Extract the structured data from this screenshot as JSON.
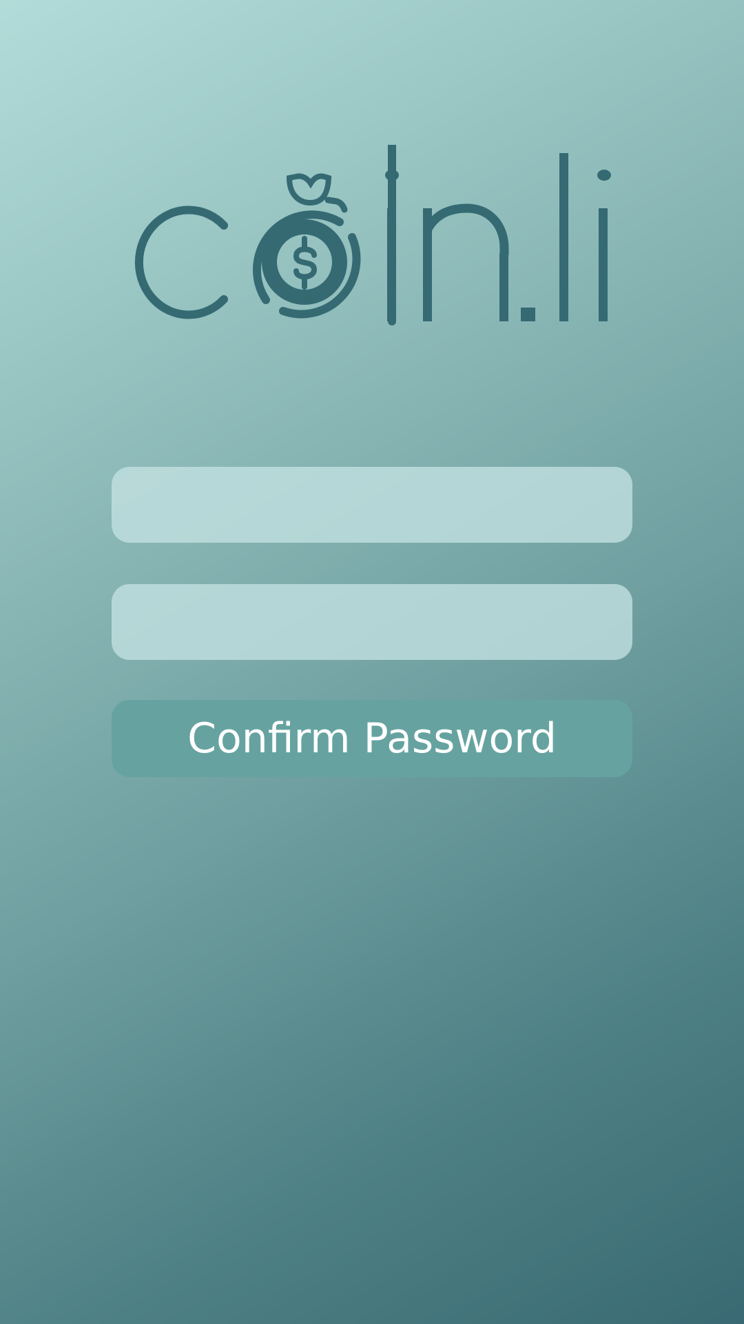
{
  "app": {
    "name": "Coin.li"
  },
  "logo": {
    "icon": "money-bag-dollar-icon",
    "color": "#356a73"
  },
  "form": {
    "fields": [
      {
        "value": "",
        "placeholder": ""
      },
      {
        "value": "",
        "placeholder": ""
      }
    ],
    "confirm_label": "Confirm Password"
  },
  "colors": {
    "field_background": "#c4e2e2",
    "button_background": "#66a3a0",
    "button_text": "#ffffff",
    "gradient_start": "#b2dcd9",
    "gradient_end": "#396a73"
  }
}
